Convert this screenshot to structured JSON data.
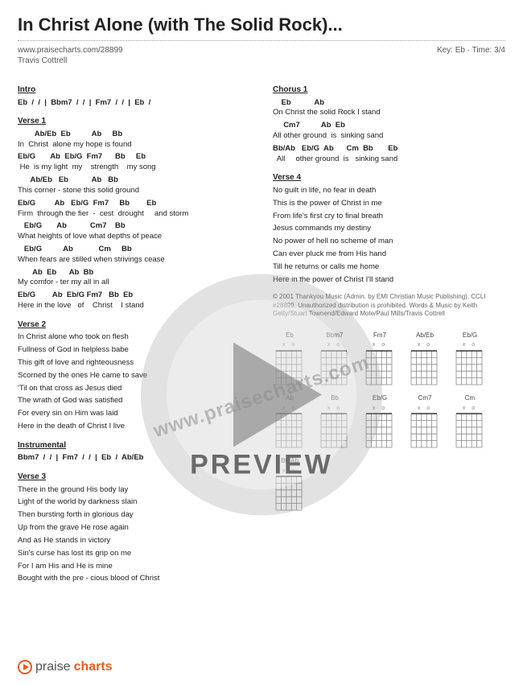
{
  "title": "In Christ Alone (with The Solid Rock)...",
  "url": "www.praisecharts.com/28899",
  "key_time": "Key: Eb · Time: 3/4",
  "artist": "Travis Cottrell",
  "intro_head": "Intro",
  "intro_chords": "Eb  /  /  |  Bbm7  /  /  |  Fm7  /  /  |  Eb  /",
  "verse1_head": "Verse 1",
  "v1": {
    "c1": "        Ab/Eb  Eb          Ab     Bb",
    "l1": "In  Christ  alone my hope is found",
    "c2": "Eb/G       Ab  Eb/G  Fm7      Bb     Eb",
    "l2": " He  is my light  my    strength    my song",
    "c3": "      Ab/Eb   Eb           Ab   Bb",
    "l3": "This corner - stone this solid ground",
    "c4": "Eb/G         Ab   Eb/G  Fm7     Bb        Eb",
    "l4": "Firm  through the fier  -  cest  drought     and storm",
    "c5": "   Eb/G       Ab           Cm7    Bb",
    "l5": "What heights of love what depths of peace",
    "c6": "   Eb/G          Ab            Cm     Bb",
    "l6": "When fears are stilled when strivings cease",
    "c7": "       Ab  Eb      Ab  Bb",
    "l7": "My comfor - ter my all in all",
    "c8": "Eb/G        Ab  Eb/G Fm7   Bb  Eb",
    "l8": "Here in the love   of    Christ    I stand"
  },
  "verse2_head": "Verse 2",
  "v2": [
    "In Christ alone who took on flesh",
    "Fullness of God in helpless babe",
    "This gift of love and righteousness",
    "Scorned by the ones He came to save",
    "'Til on that cross as Jesus died",
    "The wrath of God was satisfied",
    "For every sin on Him was laid",
    "Here in the death of Christ I live"
  ],
  "instr_head": "Instrumental",
  "instr_chords": "Bbm7  /  /  |  Fm7  /  /  |  Eb  /  Ab/Eb",
  "verse3_head": "Verse 3",
  "v3": [
    "There in the ground His body lay",
    "Light of the world by darkness slain",
    "Then bursting forth in glorious day",
    "Up from the grave He rose again",
    "And as He stands in victory",
    "Sin's curse has lost its grip on me",
    "For I am His and He is mine",
    "Bought with the pre - cious blood of Christ"
  ],
  "chorus1_head": "Chorus 1",
  "ch": {
    "c1": "    Eb           Ab",
    "l1": "On Christ the solid Rock I stand",
    "c2": "     Cm7          Ab  Eb",
    "l2": "All other ground  is  sinking sand",
    "c3": "Bb/Ab   Eb/G  Ab      Cm  Bb       Eb",
    "l3": "  All     other ground  is   sinking sand"
  },
  "verse4_head": "Verse 4",
  "v4": [
    "No guilt in life, no fear in death",
    "This is the power of Christ in me",
    "From life's first cry to final breath",
    "Jesus commands my destiny",
    "No power of hell no scheme of man",
    "Can ever pluck me from His hand",
    "Till he returns or calls me home",
    "Here in the power of Christ I'll stand"
  ],
  "copyright": "© 2001 Thankyou Music (Admin. by EMI Christian Music Publishing). CCLI #28899. Unauthorized distribution is prohibited. Words & Music by Keith Getty/Stuart Townend/Edward Mote/Paul Mills/Travis Cottrell",
  "chord_labels": [
    "Eb",
    "Bbm7",
    "Fm7",
    "Ab/Eb",
    "Eb/G",
    "Ab",
    "Bb",
    "Eb/G",
    "Cm7",
    "Cm",
    "Bb/Ab"
  ],
  "watermark_text": "www.praisecharts.com",
  "preview_text": "PREVIEW",
  "logo_text": "praise",
  "logo_text2": "charts"
}
